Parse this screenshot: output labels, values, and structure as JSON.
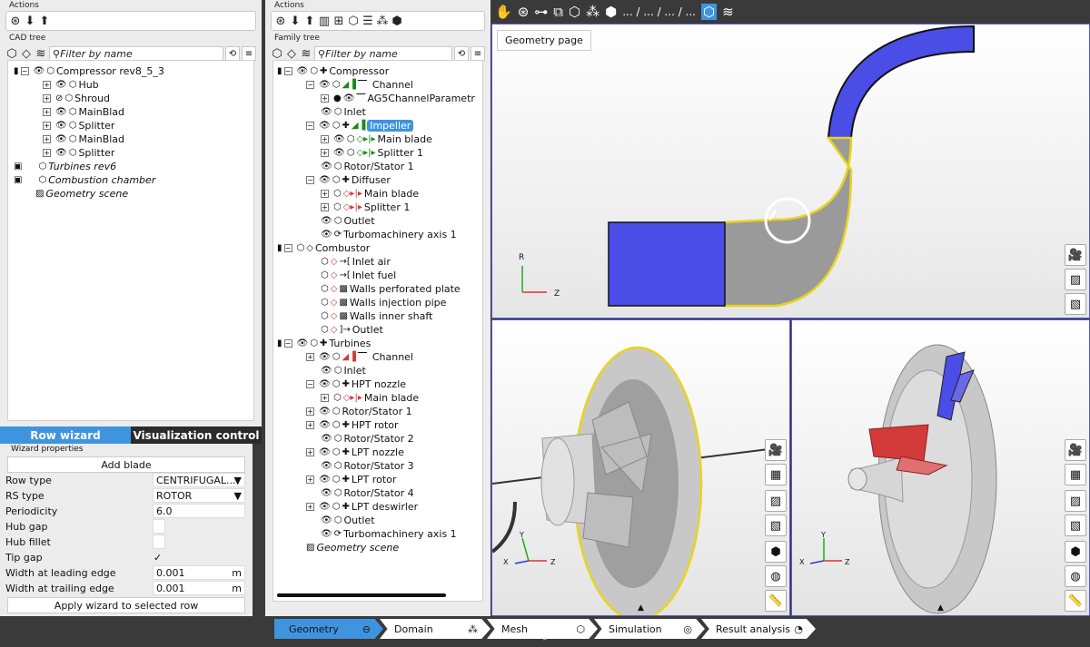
{
  "left_panel": {
    "actions_title": "Actions",
    "tree_title": "CAD tree",
    "filter_placeholder": "Filter by name",
    "items": [
      {
        "label": "Compressor rev8_5_3",
        "italic": false
      },
      {
        "label": "Hub",
        "italic": false
      },
      {
        "label": "Shroud",
        "italic": false
      },
      {
        "label": "MainBlad",
        "italic": false
      },
      {
        "label": "Splitter",
        "italic": false
      },
      {
        "label": "MainBlad",
        "italic": false
      },
      {
        "label": "Splitter",
        "italic": false
      },
      {
        "label": "Turbines rev6",
        "italic": true
      },
      {
        "label": "Combustion chamber",
        "italic": true
      },
      {
        "label": "Geometry scene",
        "italic": true
      }
    ]
  },
  "wizard": {
    "tab_row": "Row wizard",
    "tab_vis": "Visualization control",
    "props_title": "Wizard properties",
    "add_blade": "Add blade",
    "apply": "Apply wizard to selected row",
    "rows": [
      {
        "label": "Row type",
        "value": "CENTRIFUGAL..."
      },
      {
        "label": "RS type",
        "value": "ROTOR"
      },
      {
        "label": "Periodicity",
        "value": "6.0"
      },
      {
        "label": "Hub gap",
        "value": ""
      },
      {
        "label": "Hub fillet",
        "value": ""
      },
      {
        "label": "Tip gap",
        "value": "✓"
      },
      {
        "label": "Width at leading edge",
        "value": "0.001",
        "unit": "m"
      },
      {
        "label": "Width at trailing edge",
        "value": "0.001",
        "unit": "m"
      }
    ]
  },
  "family_panel": {
    "actions_title": "Actions",
    "tree_title": "Family tree",
    "filter_placeholder": "Filter by name",
    "items": [
      {
        "label": "Compressor"
      },
      {
        "label": "Channel"
      },
      {
        "label": "AG5ChannelParametr"
      },
      {
        "label": "Inlet"
      },
      {
        "label": "Impeller"
      },
      {
        "label": "Main blade"
      },
      {
        "label": "Splitter 1"
      },
      {
        "label": "Rotor/Stator 1"
      },
      {
        "label": "Diffuser"
      },
      {
        "label": "Main blade"
      },
      {
        "label": "Splitter 1"
      },
      {
        "label": "Outlet"
      },
      {
        "label": "Turbomachinery axis 1"
      },
      {
        "label": "Combustor"
      },
      {
        "label": "Inlet air"
      },
      {
        "label": "Inlet fuel"
      },
      {
        "label": "Walls perforated plate"
      },
      {
        "label": "Walls injection pipe"
      },
      {
        "label": "Walls inner shaft"
      },
      {
        "label": "Outlet"
      },
      {
        "label": "Turbines"
      },
      {
        "label": "Channel"
      },
      {
        "label": "Inlet"
      },
      {
        "label": "HPT nozzle"
      },
      {
        "label": "Main blade"
      },
      {
        "label": "Rotor/Stator 1"
      },
      {
        "label": "HPT rotor"
      },
      {
        "label": "Rotor/Stator 2"
      },
      {
        "label": "LPT nozzle"
      },
      {
        "label": "Rotor/Stator 3"
      },
      {
        "label": "LPT rotor"
      },
      {
        "label": "Rotor/Stator 4"
      },
      {
        "label": "LPT deswirler"
      },
      {
        "label": "Outlet"
      },
      {
        "label": "Turbomachinery axis 1"
      },
      {
        "label": "Geometry scene"
      }
    ]
  },
  "viewport": {
    "geometry_page": "Geometry page",
    "breadcrumb": "... / ... / ... / ...",
    "axis_r": "R",
    "axis_z": "Z",
    "axis_x": "X",
    "axis_y": "Y"
  },
  "steps": [
    {
      "label": "Geometry",
      "icon": "⊖"
    },
    {
      "label": "Domain",
      "icon": "⁂"
    },
    {
      "label": "Mesh",
      "icon": "⬡"
    },
    {
      "label": "Simulation",
      "icon": "◎"
    },
    {
      "label": "Result analysis",
      "icon": "◔"
    }
  ],
  "colors": {
    "accent": "#3f94e0",
    "blade_blue": "#4a4de6",
    "blade_red": "#d33a3a"
  }
}
